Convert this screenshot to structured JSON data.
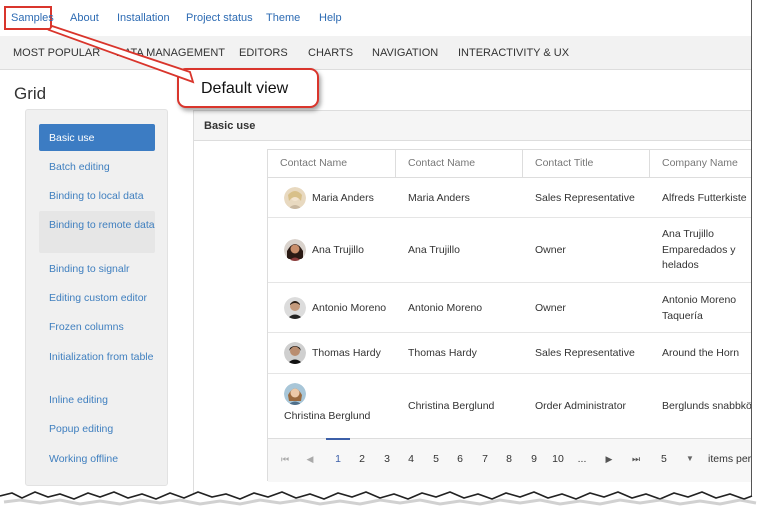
{
  "topnav": {
    "items": [
      "Samples",
      "About",
      "Installation",
      "Project status",
      "Theme",
      "Help"
    ]
  },
  "categories": [
    "MOST POPULAR",
    "DATA MANAGEMENT",
    "EDITORS",
    "CHARTS",
    "NAVIGATION",
    "INTERACTIVITY & UX"
  ],
  "callout": {
    "text": "Default view"
  },
  "page_title": "Grid",
  "sidebar": {
    "items": [
      {
        "label": "Basic use",
        "state": "active"
      },
      {
        "label": "Batch editing"
      },
      {
        "label": "Binding to local data"
      },
      {
        "label": "Binding to remote data",
        "state": "hover"
      },
      {
        "label": "Binding to signalr"
      },
      {
        "label": "Editing custom editor"
      },
      {
        "label": "Frozen columns"
      },
      {
        "label": "Initialization from table"
      },
      {
        "label": "Inline editing"
      },
      {
        "label": "Popup editing"
      },
      {
        "label": "Working offline"
      }
    ]
  },
  "panel": {
    "title": "Basic use"
  },
  "grid": {
    "columns": [
      "Contact Name",
      "Contact Name",
      "Contact Title",
      "Company Name"
    ],
    "rows": [
      {
        "avatar_name": "Maria Anders",
        "contact_name": "Maria Anders",
        "title": "Sales Representative",
        "company": "Alfreds Futterkiste"
      },
      {
        "avatar_name": "Ana Trujillo",
        "contact_name": "Ana Trujillo",
        "title": "Owner",
        "company": "Ana Trujillo\nEmparedados y\nhelados"
      },
      {
        "avatar_name": "Antonio Moreno",
        "contact_name": "Antonio Moreno",
        "title": "Owner",
        "company": "Antonio Moreno\nTaquería"
      },
      {
        "avatar_name": "Thomas Hardy",
        "contact_name": "Thomas Hardy",
        "title": "Sales Representative",
        "company": "Around the Horn"
      },
      {
        "avatar_name": "Christina Berglund",
        "contact_name": "Christina Berglund",
        "title": "Order Administrator",
        "company": "Berglunds snabbköp"
      }
    ],
    "pager": {
      "first": "⏮",
      "prev": "◀",
      "pages": [
        "1",
        "2",
        "3",
        "4",
        "5",
        "6",
        "7",
        "8",
        "9",
        "10",
        "..."
      ],
      "current": "1",
      "next": "▶",
      "last": "⏭",
      "page_size": "5",
      "items_label": "items per p"
    }
  },
  "colors": {
    "accent": "#3c7cc3",
    "link": "#2d6bb3",
    "callout_border": "#d9352c"
  }
}
